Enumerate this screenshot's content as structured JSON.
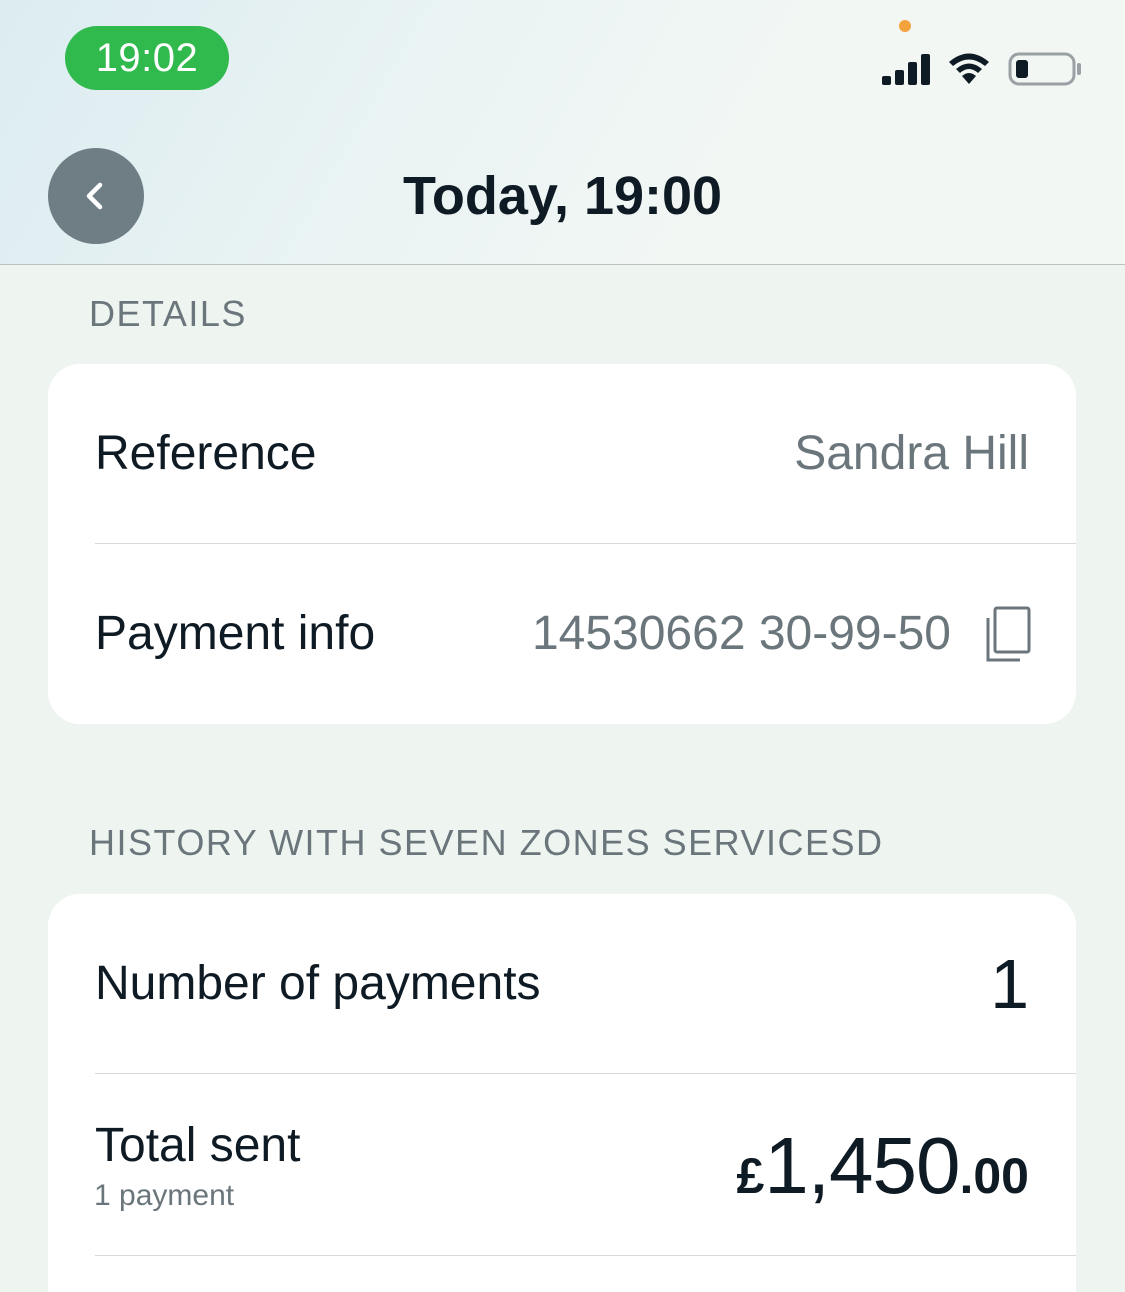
{
  "status_bar": {
    "time": "19:02",
    "recording_dot_color": "#f4a23c",
    "icons": [
      "signal-icon",
      "wifi-icon",
      "battery-icon"
    ]
  },
  "nav": {
    "back_icon": "chevron-left-icon",
    "title": "Today, 19:00"
  },
  "details": {
    "section_label": "DETAILS",
    "reference_label": "Reference",
    "reference_value": "Sandra Hill",
    "payment_info_label": "Payment info",
    "payment_info_value": "14530662 30-99-50",
    "copy_icon": "copy-icon"
  },
  "history": {
    "section_label": "HISTORY WITH SEVEN ZONES SERVICESD",
    "number_of_payments_label": "Number of payments",
    "number_of_payments_value": "1",
    "total_sent_label": "Total sent",
    "total_sent_sublabel": "1 payment",
    "total_sent_currency": "£",
    "total_sent_whole": "1,450",
    "total_sent_decimal": ".00"
  },
  "colors": {
    "accent_green": "#30b94d",
    "text_primary": "#0e1a24",
    "text_secondary": "#6a767b",
    "background": "#eef5f1"
  }
}
